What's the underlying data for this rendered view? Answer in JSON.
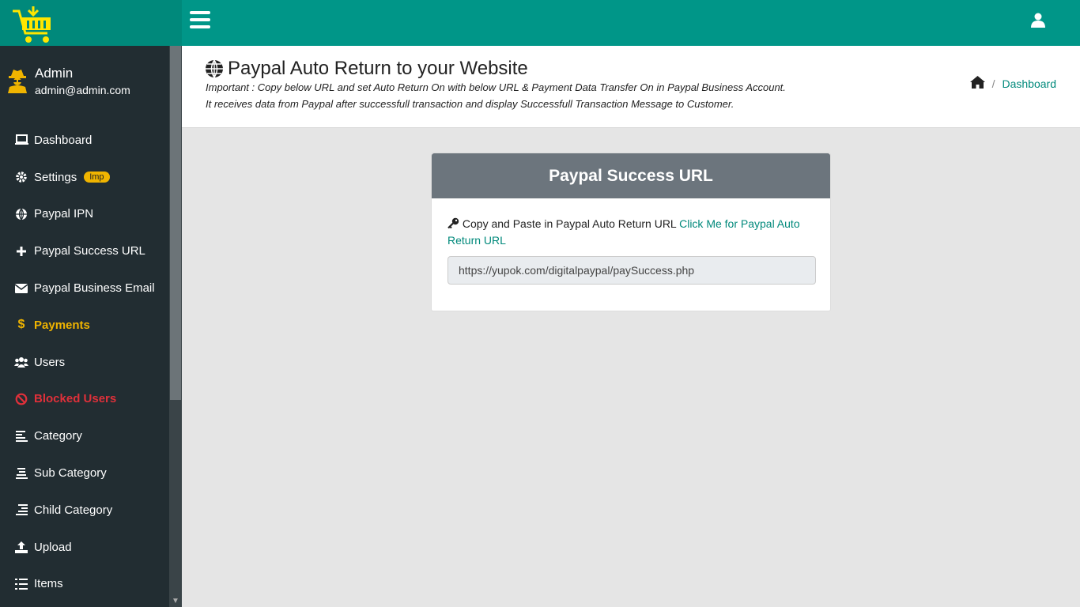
{
  "user": {
    "name": "Admin",
    "email": "admin@admin.com"
  },
  "menu": [
    {
      "label": "Dashboard",
      "icon": "laptop-icon"
    },
    {
      "label": "Settings",
      "icon": "gear-icon",
      "badge": "Imp"
    },
    {
      "label": "Paypal IPN",
      "icon": "globe-icon"
    },
    {
      "label": "Paypal Success URL",
      "icon": "plus-icon"
    },
    {
      "label": "Paypal Business Email",
      "icon": "envelope-icon"
    },
    {
      "label": "Payments",
      "icon": "dollar-icon"
    },
    {
      "label": "Users",
      "icon": "users-icon"
    },
    {
      "label": "Blocked Users",
      "icon": "ban-icon"
    },
    {
      "label": "Category",
      "icon": "align-left-icon"
    },
    {
      "label": "Sub Category",
      "icon": "align-center-icon"
    },
    {
      "label": "Child Category",
      "icon": "align-right-icon"
    },
    {
      "label": "Upload",
      "icon": "upload-icon"
    },
    {
      "label": "Items",
      "icon": "list-icon"
    }
  ],
  "header": {
    "title": "Paypal Auto Return to your Website",
    "desc1": "Important : Copy below URL and set Auto Return On with below URL & Payment Data Transfer On in Paypal Business Account.",
    "desc2": "It receives data from Paypal after successfull transaction and display Successfull Transaction Message to Customer."
  },
  "breadcrumb": {
    "current": "Dashboard"
  },
  "card": {
    "title": "Paypal Success URL",
    "instruction": "Copy and Paste in Paypal Auto Return URL",
    "link_text": "Click Me for Paypal Auto Return URL",
    "url_value": "https://yupok.com/digitalpaypal/paySuccess.php"
  },
  "colors": {
    "primary": "#009688",
    "sidebar": "#222d32",
    "payments": "#f0b400",
    "blocked": "#e0303a",
    "card_header": "#6c757d"
  }
}
